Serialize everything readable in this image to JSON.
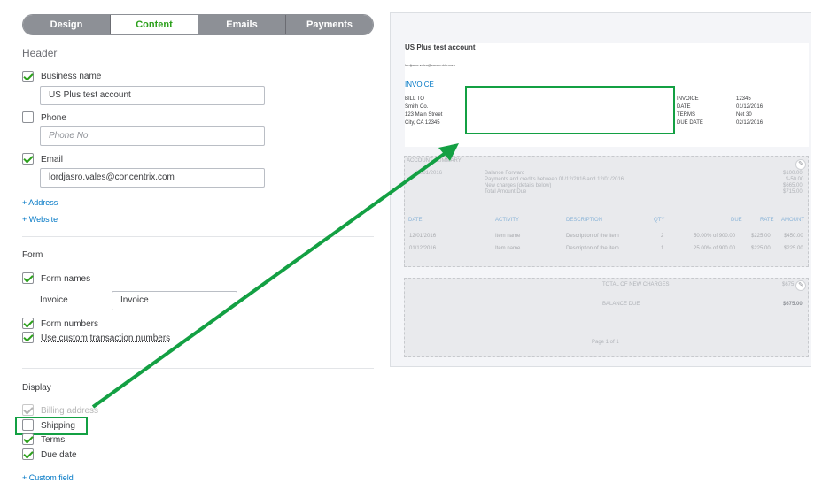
{
  "tabs": [
    "Design",
    "Content",
    "Emails",
    "Payments"
  ],
  "header": {
    "title": "Header",
    "business_name_label": "Business name",
    "business_name_value": "US Plus test account",
    "phone_label": "Phone",
    "phone_placeholder": "Phone No",
    "email_label": "Email",
    "email_value": "lordjasro.vales@concentrix.com",
    "address_link": "+ Address",
    "website_link": "+ Website"
  },
  "form": {
    "title": "Form",
    "form_names_label": "Form names",
    "invoice_label": "Invoice",
    "invoice_value": "Invoice",
    "form_numbers_label": "Form numbers",
    "custom_numbers_label": "Use custom transaction numbers"
  },
  "display": {
    "title": "Display",
    "billing_label": "Billing address",
    "shipping_label": "Shipping",
    "terms_label": "Terms",
    "due_date_label": "Due date",
    "custom_field_link": "+ Custom field"
  },
  "preview": {
    "company": "US Plus test account",
    "email": "lordjasro.vales@concentrix.com",
    "invoice_title": "INVOICE",
    "bill_to_label": "BILL TO",
    "bill_to": [
      "Smith Co.",
      "123 Main Street",
      "City, CA 12345"
    ],
    "meta_labels": [
      "INVOICE",
      "DATE",
      "TERMS",
      "DUE DATE"
    ],
    "meta_values": [
      "12345",
      "01/12/2016",
      "Net 30",
      "02/12/2016"
    ],
    "account_summary": "ACCOUNT SUMMARY",
    "summary_date": "12/01/2016",
    "summary_rows": [
      "Balance Forward",
      "Payments and credits between 01/12/2016 and 12/01/2016",
      "New charges (details below)",
      "Total Amount Due"
    ],
    "summary_values": [
      "$100.00",
      "$-50.00",
      "$665.00",
      "$715.00"
    ],
    "table_headers": [
      "DATE",
      "ACTIVITY",
      "DESCRIPTION",
      "QTY",
      "DUE",
      "RATE",
      "AMOUNT"
    ],
    "rows": [
      [
        "12/01/2016",
        "Item name",
        "Description of the item",
        "2",
        "50.00% of 900.00",
        "$225.00",
        "$450.00"
      ],
      [
        "01/12/2016",
        "Item name",
        "Description of the item",
        "1",
        "25.00% of 900.00",
        "$225.00",
        "$225.00"
      ]
    ],
    "total_new_label": "TOTAL OF NEW CHARGES",
    "total_new_value": "$675",
    "balance_due_label": "BALANCE DUE",
    "balance_due_value": "$675.00",
    "page_label": "Page 1 of 1"
  },
  "colors": {
    "accent": "#2ca01c",
    "highlight": "#13a043",
    "link": "#0077c5"
  }
}
